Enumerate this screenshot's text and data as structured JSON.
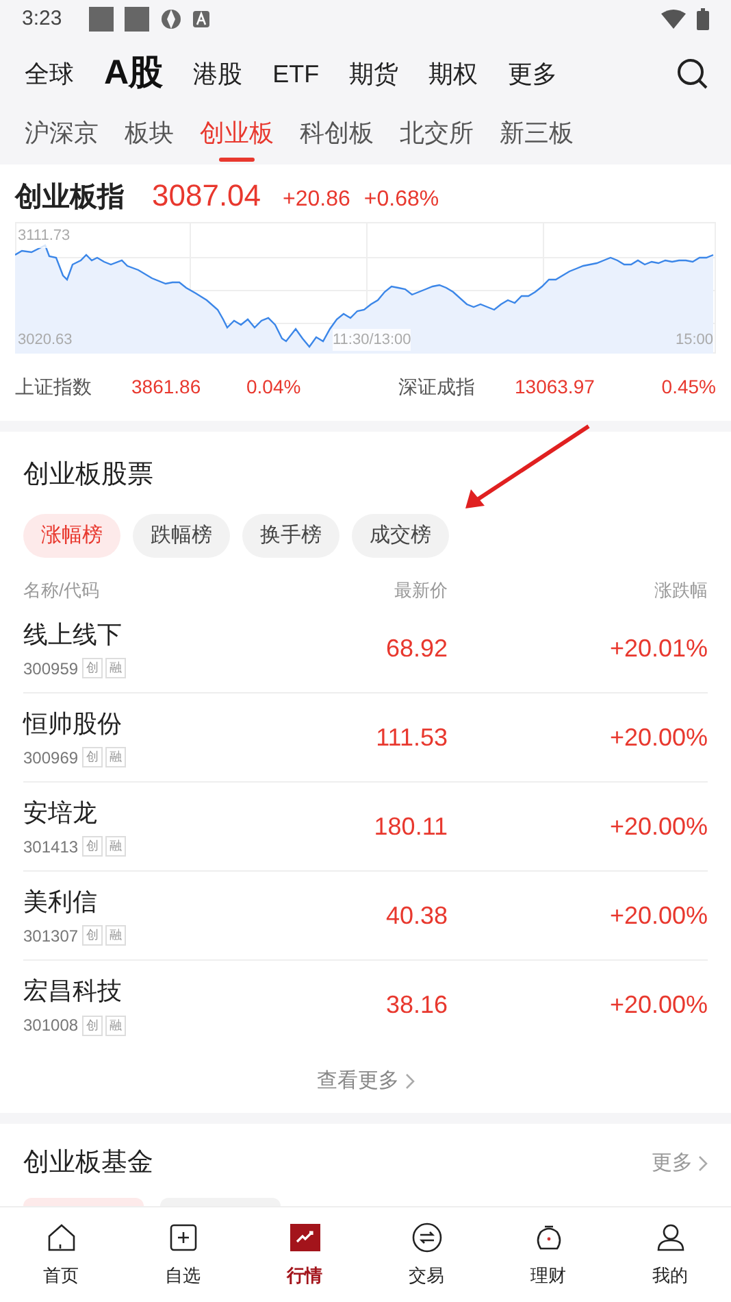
{
  "status_bar": {
    "time": "3:23"
  },
  "market_tabs": [
    {
      "label": "全球",
      "selected": false
    },
    {
      "label": "A股",
      "selected": true
    },
    {
      "label": "港股",
      "selected": false
    },
    {
      "label": "ETF",
      "selected": false
    },
    {
      "label": "期货",
      "selected": false
    },
    {
      "label": "期权",
      "selected": false
    },
    {
      "label": "更多",
      "selected": false
    }
  ],
  "board_tabs": [
    {
      "label": "沪深京",
      "selected": false
    },
    {
      "label": "板块",
      "selected": false
    },
    {
      "label": "创业板",
      "selected": true
    },
    {
      "label": "科创板",
      "selected": false
    },
    {
      "label": "北交所",
      "selected": false
    },
    {
      "label": "新三板",
      "selected": false
    }
  ],
  "index": {
    "name": "创业板指",
    "value": "3087.04",
    "change": "+20.86",
    "percent": "+0.68%",
    "chart": {
      "high": "3111.73",
      "low": "3020.63",
      "mid_time": "11:30/13:00",
      "end_time": "15:00"
    }
  },
  "other_indices": [
    {
      "name": "上证指数",
      "value": "3861.86",
      "percent": "0.04%"
    },
    {
      "name": "深证成指",
      "value": "13063.97",
      "percent": "0.45%"
    }
  ],
  "stocks_section": {
    "title": "创业板股票",
    "chips": [
      {
        "label": "涨幅榜",
        "selected": true
      },
      {
        "label": "跌幅榜",
        "selected": false
      },
      {
        "label": "换手榜",
        "selected": false
      },
      {
        "label": "成交榜",
        "selected": false
      }
    ],
    "columns": [
      "名称/代码",
      "最新价",
      "涨跌幅"
    ],
    "rows": [
      {
        "name": "线上线下",
        "code": "300959",
        "tags": [
          "创",
          "融"
        ],
        "price": "68.92",
        "change": "+20.01%"
      },
      {
        "name": "恒帅股份",
        "code": "300969",
        "tags": [
          "创",
          "融"
        ],
        "price": "111.53",
        "change": "+20.00%"
      },
      {
        "name": "安培龙",
        "code": "301413",
        "tags": [
          "创",
          "融"
        ],
        "price": "180.11",
        "change": "+20.00%"
      },
      {
        "name": "美利信",
        "code": "301307",
        "tags": [
          "创",
          "融"
        ],
        "price": "40.38",
        "change": "+20.00%"
      },
      {
        "name": "宏昌科技",
        "code": "301008",
        "tags": [
          "创",
          "融"
        ],
        "price": "38.16",
        "change": "+20.00%"
      }
    ],
    "more": "查看更多"
  },
  "funds_section": {
    "title": "创业板基金",
    "more": "更多"
  },
  "bottom_nav": [
    {
      "label": "首页",
      "kind": "home",
      "selected": false
    },
    {
      "label": "自选",
      "kind": "add",
      "selected": false
    },
    {
      "label": "行情",
      "kind": "market",
      "selected": true
    },
    {
      "label": "交易",
      "kind": "trade",
      "selected": false
    },
    {
      "label": "理财",
      "kind": "wealth",
      "selected": false
    },
    {
      "label": "我的",
      "kind": "me",
      "selected": false
    }
  ]
}
